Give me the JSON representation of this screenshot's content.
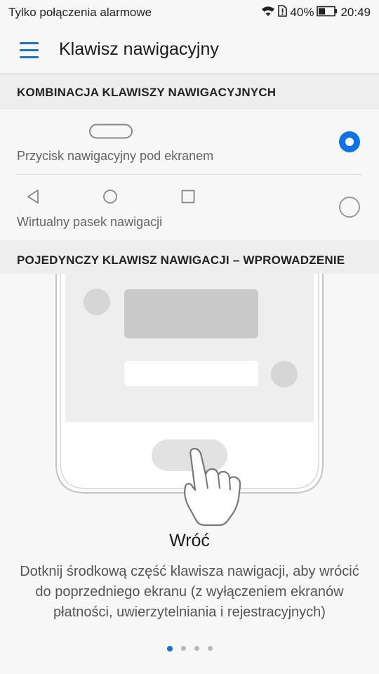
{
  "status_bar": {
    "carrier": "Tylko połączenia alarmowe",
    "battery": "40%",
    "time": "20:49"
  },
  "app_bar": {
    "title": "Klawisz nawigacyjny"
  },
  "sections": {
    "combination": {
      "header": "KOMBINACJA KLAWISZY NAWIGACYJNYCH",
      "options": [
        {
          "label": "Przycisk nawigacyjny pod ekranem",
          "selected": true
        },
        {
          "label": "Wirtualny pasek nawigacji",
          "selected": false
        }
      ]
    },
    "intro": {
      "header": "POJEDYNCZY KLAWISZ NAWIGACJI – WPROWADZENIE",
      "gesture_title": "Wróć",
      "description": "Dotknij środkową część klawisza nawigacji, aby wrócić do poprzedniego ekranu (z wyłączeniem ekranów płatności, uwierzytelniania i rejestracyjnych)",
      "page_count": 4,
      "active_page": 1
    }
  },
  "colors": {
    "accent": "#0a74e6",
    "background": "#f7f7f7",
    "section_header": "#eeeeee"
  },
  "icons": {
    "menu": "hamburger-icon",
    "wifi": "wifi-icon",
    "sim_alert": "sim-alert-icon",
    "battery": "battery-icon",
    "nav_pill": "nav-pill-icon",
    "back": "back-triangle-icon",
    "home": "home-circle-icon",
    "recents": "recents-square-icon",
    "hand": "hand-pointer-icon"
  }
}
